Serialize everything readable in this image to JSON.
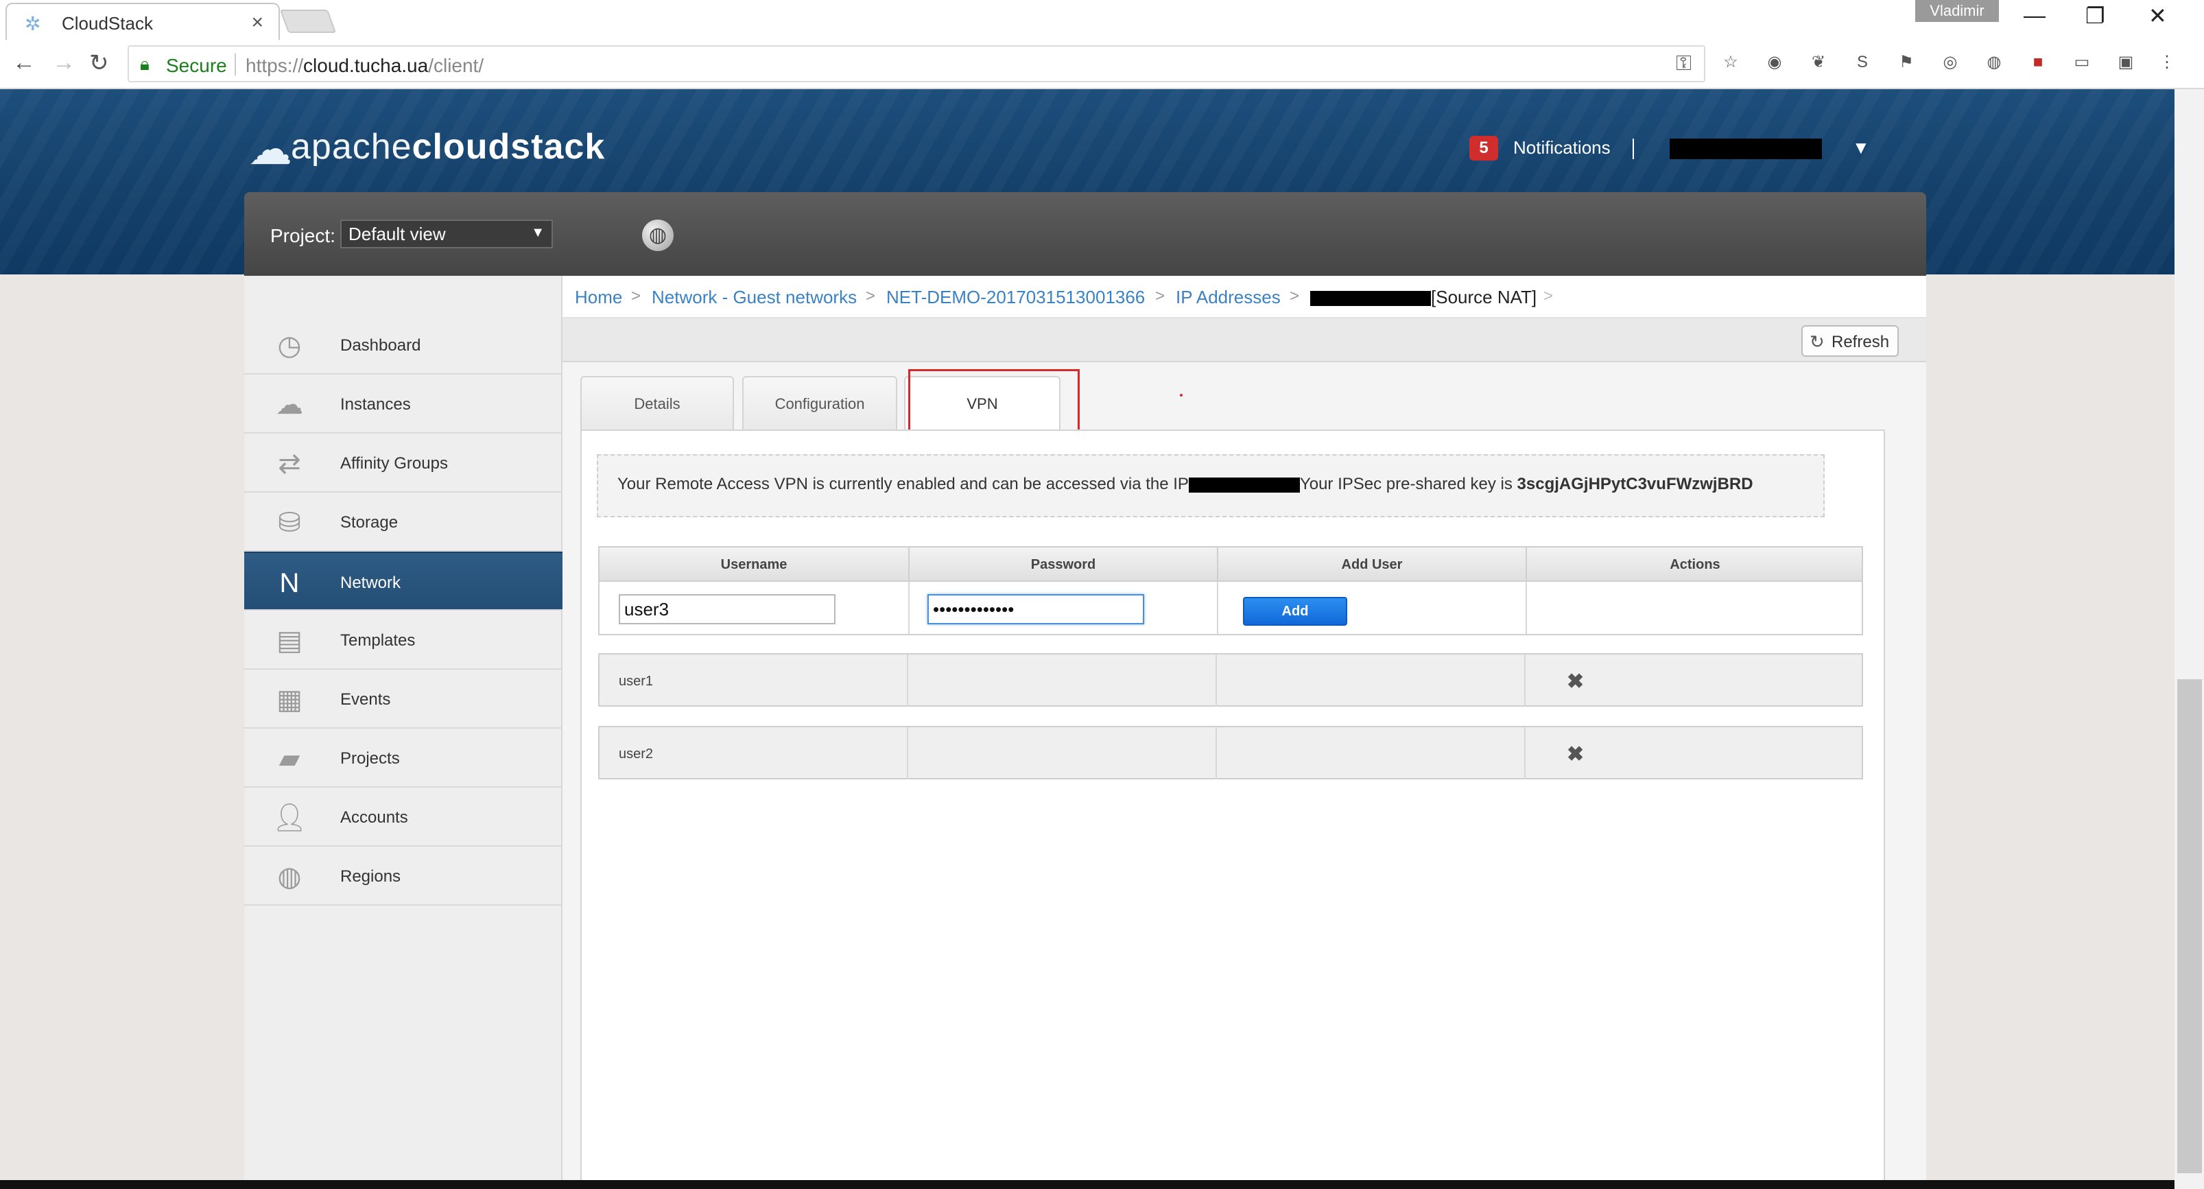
{
  "browser": {
    "tab_title": "CloudStack",
    "tab_close": "×",
    "user_chip": "Vladimir",
    "secure_label": "Secure",
    "url_scheme": "https://",
    "url_host": "cloud.tucha.ua",
    "url_path": "/client/"
  },
  "header": {
    "logo_prefix": "apache",
    "logo_name": "cloudstack",
    "notifications_count": "5",
    "notifications_label": "Notifications",
    "separator": "|"
  },
  "project": {
    "label": "Project:",
    "selected": "Default view"
  },
  "sidebar": {
    "items": [
      {
        "label": "Dashboard",
        "icon": "dashboard-icon"
      },
      {
        "label": "Instances",
        "icon": "cloud-icon"
      },
      {
        "label": "Affinity Groups",
        "icon": "affinity-icon"
      },
      {
        "label": "Storage",
        "icon": "storage-icon"
      },
      {
        "label": "Network",
        "icon": "network-icon",
        "active": true
      },
      {
        "label": "Templates",
        "icon": "templates-icon"
      },
      {
        "label": "Events",
        "icon": "calendar-icon"
      },
      {
        "label": "Projects",
        "icon": "folder-icon"
      },
      {
        "label": "Accounts",
        "icon": "user-icon"
      },
      {
        "label": "Regions",
        "icon": "globe-icon"
      }
    ]
  },
  "breadcrumb": {
    "home": "Home",
    "network": "Network - Guest networks",
    "net_name": "NET-DEMO-2017031513001366",
    "ip_addresses": "IP Addresses",
    "current_suffix": "[Source NAT]",
    "sep": ">"
  },
  "toolbar": {
    "refresh_label": "Refresh"
  },
  "tabs": {
    "details": "Details",
    "configuration": "Configuration",
    "vpn": "VPN"
  },
  "vpn": {
    "message_prefix": "Your Remote Access VPN is currently enabled and can be accessed via the IP",
    "message_middle": "Your IPSec pre-shared key is ",
    "psk": "3scgjAGjHPytC3vuFWzwjBRD"
  },
  "vpn_table": {
    "headers": {
      "username": "Username",
      "password": "Password",
      "add_user": "Add User",
      "actions": "Actions"
    },
    "new_user": {
      "username_value": "user3",
      "password_value": "•••••••••••••",
      "add_label": "Add"
    },
    "users": [
      {
        "username": "user1"
      },
      {
        "username": "user2"
      }
    ]
  }
}
